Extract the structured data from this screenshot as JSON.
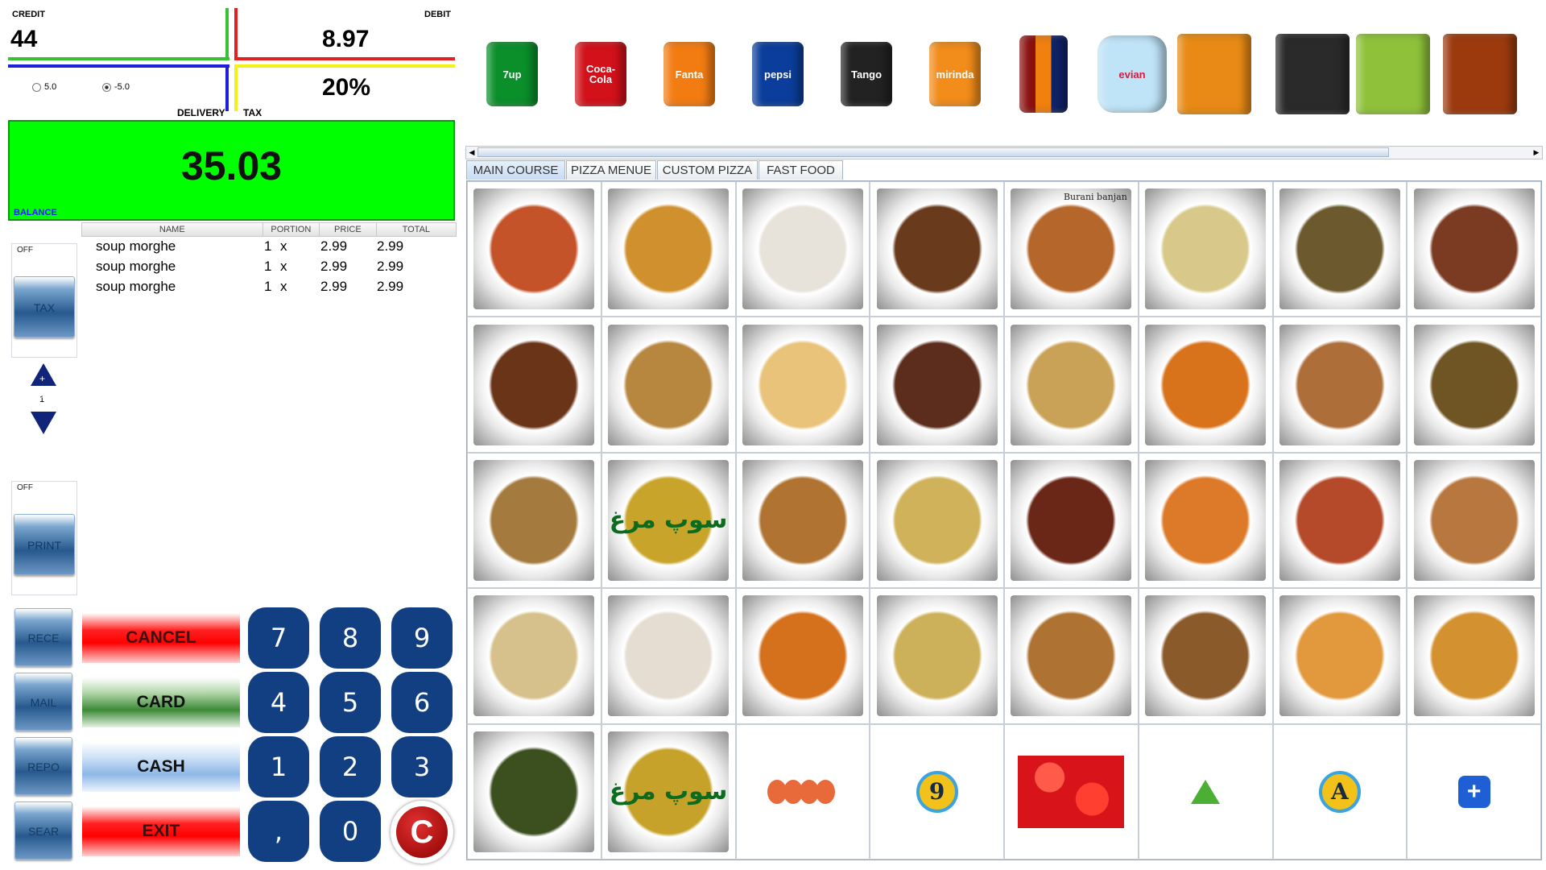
{
  "summary": {
    "credit_label": "CREDIT",
    "credit_value": "44",
    "debit_label": "DEBIT",
    "debit_value": "8.97",
    "delivery_label": "DELIVERY",
    "tax_label": "TAX",
    "tax_value": "20%",
    "radio_options": [
      "5.0",
      "-5.0"
    ],
    "radio_selected": "-5.0"
  },
  "balance": {
    "label": "BALANCE",
    "value": "35.03"
  },
  "order": {
    "columns": [
      "NAME",
      "PORTION",
      "PRICE",
      "TOTAL"
    ],
    "rows": [
      {
        "name": "soup morghe",
        "portion": "1",
        "x": "x",
        "price": "2.99",
        "total": "2.99"
      },
      {
        "name": "soup morghe",
        "portion": "1",
        "x": "x",
        "price": "2.99",
        "total": "2.99"
      },
      {
        "name": "soup morghe",
        "portion": "1",
        "x": "x",
        "price": "2.99",
        "total": "2.99"
      }
    ]
  },
  "toggles": {
    "tax": {
      "state": "OFF",
      "label": "TAX"
    },
    "print": {
      "state": "OFF",
      "label": "PRINT"
    },
    "quantity": "1",
    "up": "+",
    "down": "-"
  },
  "side_buttons": [
    "RECE",
    "MAIL",
    "REPO",
    "SEAR"
  ],
  "actions": {
    "cancel": "CANCEL",
    "card": "CARD",
    "cash": "CASH",
    "exit": "EXIT"
  },
  "keypad": [
    "7",
    "8",
    "9",
    "4",
    "5",
    "6",
    "1",
    "2",
    "3",
    ",",
    "0",
    "C"
  ],
  "drinks": [
    {
      "name": "7up",
      "label": "7up",
      "color": "#0a8f2b"
    },
    {
      "name": "coca-cola",
      "label": "Coca-Cola",
      "color": "#d2111a"
    },
    {
      "name": "fanta",
      "label": "Fanta",
      "color": "#f37c12"
    },
    {
      "name": "pepsi",
      "label": "pepsi",
      "color": "#0b3e9c"
    },
    {
      "name": "tango",
      "label": "Tango",
      "color": "#222222"
    },
    {
      "name": "mirinda",
      "label": "mirinda",
      "color": "#f28c1a"
    },
    {
      "name": "bottles",
      "label": "",
      "color": "#8a2020"
    },
    {
      "name": "evian",
      "label": "evian",
      "color": "#bfe3f7"
    },
    {
      "name": "orange-tea",
      "label": "",
      "color": "#e88a15"
    },
    {
      "name": "coffee",
      "label": "",
      "color": "#2a2a2a"
    },
    {
      "name": "green-tea",
      "label": "",
      "color": "#8fc23a"
    },
    {
      "name": "black-tea",
      "label": "",
      "color": "#9c3a0e"
    }
  ],
  "tabs": [
    "MAIN COURSE",
    "PIZZA MENUE",
    "CUSTOM PIZZA",
    "FAST FOOD"
  ],
  "active_tab": "MAIN COURSE",
  "food_tiles": [
    {
      "icon": "salad-dish",
      "color": "#c5532a"
    },
    {
      "icon": "potato-dish",
      "color": "#d0902e"
    },
    {
      "icon": "yogurt-dish",
      "color": "#e7e2da"
    },
    {
      "icon": "stew-dish",
      "color": "#6a3a1c"
    },
    {
      "icon": "burani-banjan",
      "color": "#b5662a"
    },
    {
      "icon": "vegetable-dish",
      "color": "#d8c98a"
    },
    {
      "icon": "kofta-dish",
      "color": "#6c5a2e"
    },
    {
      "icon": "kebab-skewers",
      "color": "#7b3a22"
    },
    {
      "icon": "grilled-skewers",
      "color": "#6a3418"
    },
    {
      "icon": "chicken-skewers",
      "color": "#b8873f"
    },
    {
      "icon": "flatbread",
      "color": "#e9c37a"
    },
    {
      "icon": "grilled-meat",
      "color": "#5c2d1c"
    },
    {
      "icon": "fish-and-chips",
      "color": "#c9a257"
    },
    {
      "icon": "bean-stew",
      "color": "#d8731c"
    },
    {
      "icon": "kebab-plate",
      "color": "#ad6e3a"
    },
    {
      "icon": "meat-stew",
      "color": "#6f5424"
    },
    {
      "icon": "rice-chicken",
      "color": "#a47a3e"
    },
    {
      "icon": "soup-bowl",
      "color": "#c8a52a"
    },
    {
      "icon": "soup-yogurt",
      "color": "#b07332"
    },
    {
      "icon": "rice-lamb",
      "color": "#cfb25a"
    },
    {
      "icon": "meatballs",
      "color": "#6a2616"
    },
    {
      "icon": "curry-pot",
      "color": "#dd7a2a"
    },
    {
      "icon": "curry-bowl",
      "color": "#b54a2a"
    },
    {
      "icon": "grilled-chicken",
      "color": "#b7773e"
    },
    {
      "icon": "cauliflower-dish",
      "color": "#d6c08c"
    },
    {
      "icon": "yogurt-dish",
      "color": "#e5ddd2"
    },
    {
      "icon": "bean-stew",
      "color": "#d5701c"
    },
    {
      "icon": "rice-lamb",
      "color": "#cdb05a"
    },
    {
      "icon": "soup-yogurt",
      "color": "#ae7232"
    },
    {
      "icon": "fried-fish",
      "color": "#8a5a2a"
    },
    {
      "icon": "pastry",
      "color": "#e2993e"
    },
    {
      "icon": "potato-dish",
      "color": "#d49130"
    },
    {
      "icon": "spinach-dish",
      "color": "#3c4f1e"
    },
    {
      "icon": "soup-bowl",
      "color": "#c6a22a"
    },
    {
      "icon": "pepperoni-icon",
      "color": "#e86a3a"
    },
    {
      "icon": "nine-badge-icon",
      "color": "#f2c21a"
    },
    {
      "icon": "tomatoes-icon",
      "color": "#d8141a"
    },
    {
      "icon": "triangle-icon",
      "color": "#4caf35"
    },
    {
      "icon": "a-badge-icon",
      "color": "#f2c21a"
    },
    {
      "icon": "add-icon",
      "color": "#1f5fd6"
    }
  ],
  "tile_texts": {
    "tile4": "Burani banjan",
    "soup_script": "سوپ مرغ",
    "nine": "9",
    "a": "A",
    "plus": "+"
  }
}
